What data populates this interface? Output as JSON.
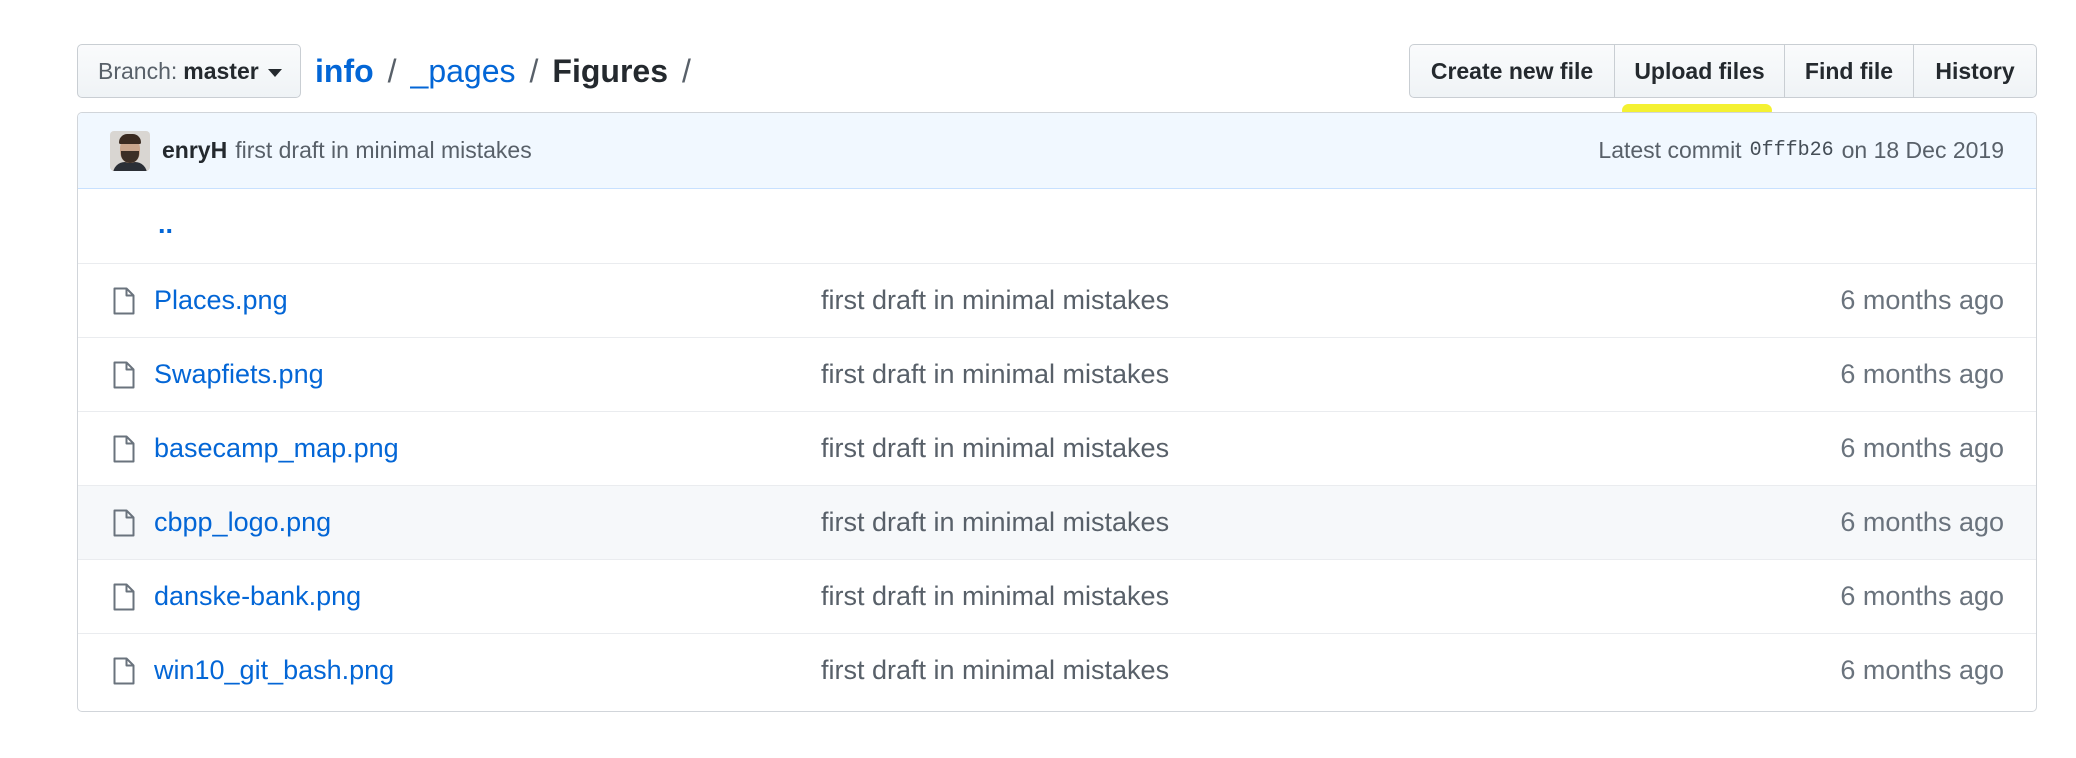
{
  "branch": {
    "label": "Branch:",
    "value": "master"
  },
  "breadcrumb": {
    "root": "info",
    "path": [
      "_pages",
      "Figures"
    ],
    "separator": "/"
  },
  "actions": {
    "create_new_file": "Create new file",
    "upload_files": "Upload files",
    "find_file": "Find file",
    "history": "History"
  },
  "commit": {
    "author": "enryH",
    "message": "first draft in minimal mistakes",
    "latest_label": "Latest commit",
    "sha": "0fffb26",
    "date_text": "on 18 Dec 2019"
  },
  "up_dir": "..",
  "files": [
    {
      "name": "Places.png",
      "message": "first draft in minimal mistakes",
      "age": "6 months ago"
    },
    {
      "name": "Swapfiets.png",
      "message": "first draft in minimal mistakes",
      "age": "6 months ago"
    },
    {
      "name": "basecamp_map.png",
      "message": "first draft in minimal mistakes",
      "age": "6 months ago"
    },
    {
      "name": "cbpp_logo.png",
      "message": "first draft in minimal mistakes",
      "age": "6 months ago"
    },
    {
      "name": "danske-bank.png",
      "message": "first draft in minimal mistakes",
      "age": "6 months ago"
    },
    {
      "name": "win10_git_bash.png",
      "message": "first draft in minimal mistakes",
      "age": "6 months ago"
    }
  ],
  "icons": {
    "file": "file-icon",
    "caret": "caret-down-icon"
  },
  "colors": {
    "link": "#0366d6",
    "highlight": "#f3f01c",
    "commit_bar": "#f1f8ff"
  }
}
